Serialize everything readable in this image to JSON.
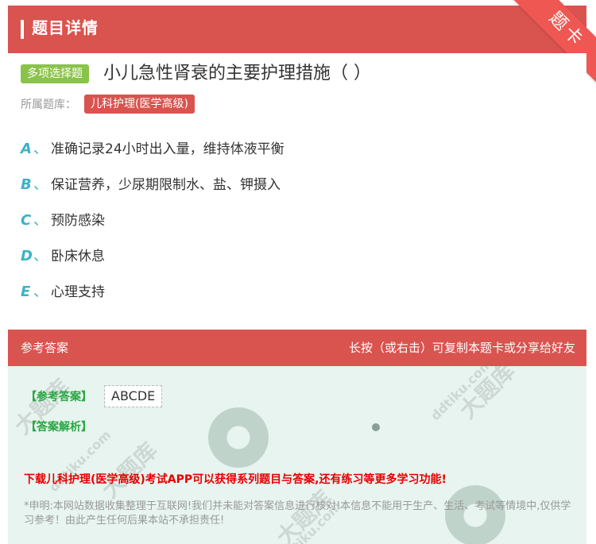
{
  "header": {
    "title": "题目详情",
    "corner_label": "题卡"
  },
  "question": {
    "type_badge": "多项选择题",
    "title": "小儿急性肾衰的主要护理措施（ ）",
    "bank_label": "所属题库：",
    "bank_name": "儿科护理(医学高级)",
    "options": [
      {
        "letter": "A",
        "text": "准确记录24小时出入量，维持体液平衡"
      },
      {
        "letter": "B",
        "text": "保证营养，少尿期限制水、盐、钾摄入"
      },
      {
        "letter": "C",
        "text": "预防感染"
      },
      {
        "letter": "D",
        "text": "卧床休息"
      },
      {
        "letter": "E",
        "text": "心理支持"
      }
    ],
    "option_separator": "、"
  },
  "answer_bar": {
    "left": "参考答案",
    "right": "长按（或右击）可复制本题卡或分享给好友"
  },
  "answer": {
    "ref_label": "【参考答案】",
    "ref_value": "ABCDE",
    "explain_label": "【答案解析】",
    "download_text": "下载儿科护理(医学高级)考试APP可以获得系列题目与答案,还有练习等更多学习功能!",
    "disclaimer": "*申明:本网站数据收集整理于互联网!我们并未能对答案信息进行核对!本信息不能用于生产、生活、考试等情境中,仅供学习参考！由此产生任何后果本站不承担责任!"
  },
  "watermark": {
    "brand": "大题库",
    "site": "ddtiku.com"
  },
  "colors": {
    "header_red": "#d9534f",
    "type_green": "#8bc34a",
    "option_teal": "#3bb2c6",
    "answer_green": "#27a641",
    "alert_red": "#e60000",
    "answer_bg": "#e7f4ef"
  }
}
